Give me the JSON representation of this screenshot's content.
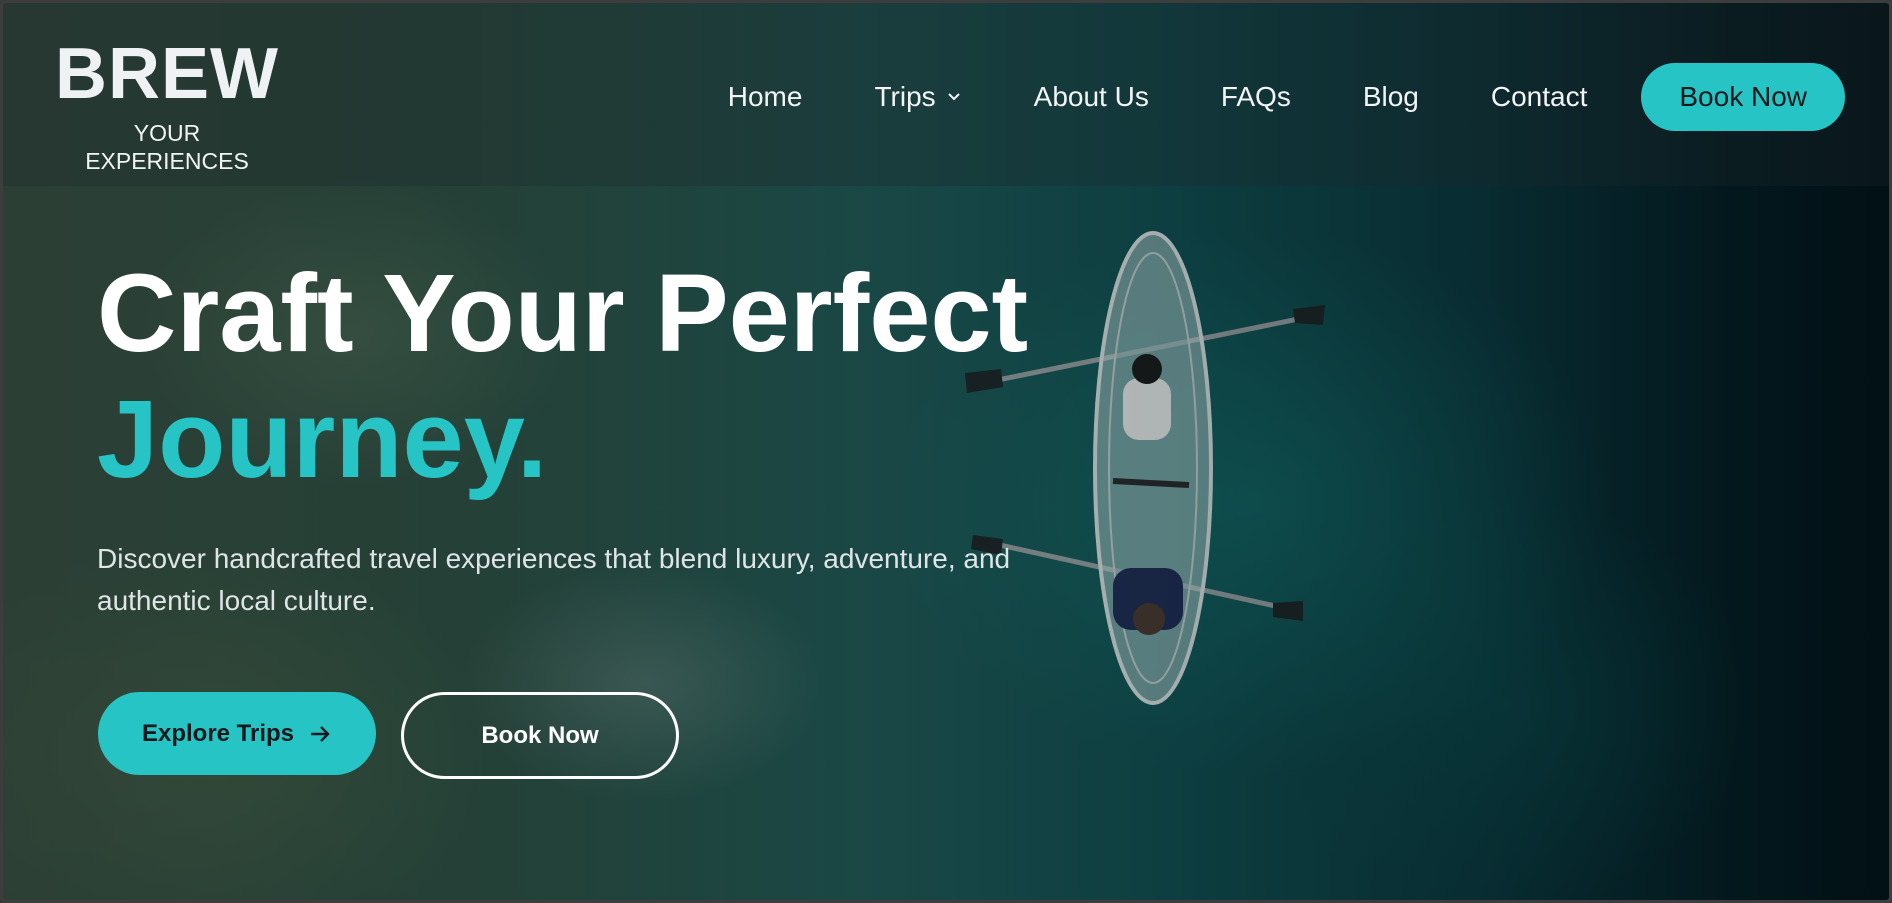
{
  "brand": {
    "name": "BREW",
    "tagline": "YOUR EXPERIENCES"
  },
  "nav": {
    "items": [
      {
        "label": "Home"
      },
      {
        "label": "Trips",
        "has_dropdown": true
      },
      {
        "label": "About Us"
      },
      {
        "label": "FAQs"
      },
      {
        "label": "Blog"
      },
      {
        "label": "Contact"
      }
    ],
    "cta_label": "Book Now"
  },
  "hero": {
    "headline_line1": "Craft Your Perfect",
    "headline_line2": "Journey.",
    "description": "Discover handcrafted travel experiences that blend luxury, adventure, and authentic local culture.",
    "primary_button": "Explore Trips",
    "secondary_button": "Book Now"
  },
  "icons": {
    "trips_dropdown": "chevron-down-icon",
    "explore_arrow": "arrow-right-icon"
  },
  "colors": {
    "accent": "#27c4c6",
    "text_light": "#ffffff",
    "button_text_dark": "#0e1a1c"
  }
}
